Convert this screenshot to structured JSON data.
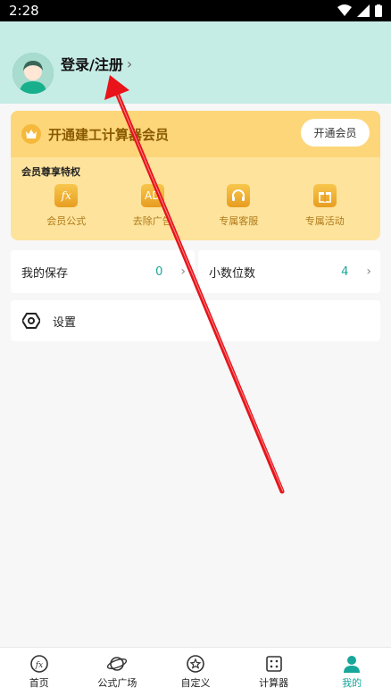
{
  "status_bar": {
    "time": "2:28"
  },
  "header": {
    "login_label": "登录/注册"
  },
  "vip": {
    "title": "开通建工计算器会员",
    "button_label": "开通会员",
    "subtitle": "会员尊享特权",
    "perks": [
      {
        "label": "会员公式",
        "icon": "fx-icon"
      },
      {
        "label": "去除广告",
        "icon": "ad-icon"
      },
      {
        "label": "专属客服",
        "icon": "headset-icon"
      },
      {
        "label": "专属活动",
        "icon": "gift-icon"
      }
    ]
  },
  "rows": {
    "saved": {
      "label": "我的保存",
      "value": "0"
    },
    "decimals": {
      "label": "小数位数",
      "value": "4"
    }
  },
  "settings": {
    "label": "设置"
  },
  "tabs": [
    {
      "label": "首页",
      "icon": "fx-icon"
    },
    {
      "label": "公式广场",
      "icon": "planet-icon"
    },
    {
      "label": "自定义",
      "icon": "star-circle-icon"
    },
    {
      "label": "计算器",
      "icon": "calculator-icon"
    },
    {
      "label": "我的",
      "icon": "person-icon"
    }
  ],
  "colors": {
    "header_bg": "#c6ece6",
    "accent": "#17a79a",
    "vip_bg": "#fde39c",
    "vip_top": "#fdd679",
    "annotation_arrow": "#e8141a"
  }
}
